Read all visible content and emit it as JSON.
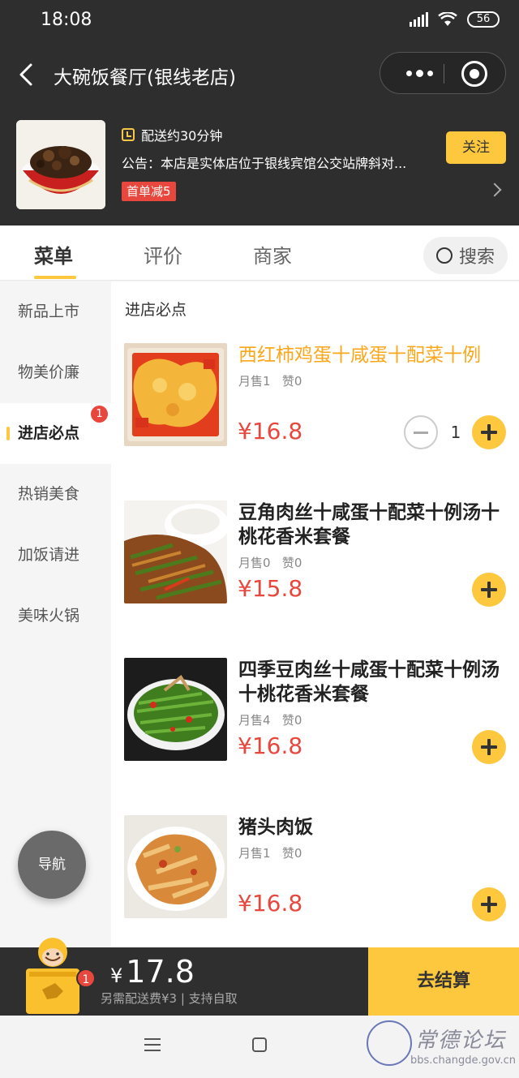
{
  "status_bar": {
    "time": "18:08",
    "battery": "56"
  },
  "header": {
    "title": "大碗饭餐厅(银线老店)"
  },
  "shop": {
    "delivery": "配送约30分钟",
    "notice": "公告：本店是实体店位于银线宾馆公交站牌斜对...",
    "promo": "首单减5",
    "follow_label": "关注"
  },
  "tabs": [
    {
      "label": "菜单",
      "active": true
    },
    {
      "label": "评价",
      "active": false
    },
    {
      "label": "商家",
      "active": false
    }
  ],
  "search_label": "搜索",
  "sidebar": {
    "items": [
      {
        "label": "新品上市"
      },
      {
        "label": "物美价廉"
      },
      {
        "label": "进店必点",
        "active": true,
        "badge": "1"
      },
      {
        "label": "热销美食"
      },
      {
        "label": "加饭请进"
      },
      {
        "label": "美味火锅"
      }
    ],
    "nav_button": "导航"
  },
  "section_title": "进店必点",
  "dishes": [
    {
      "name": "西红柿鸡蛋十咸蛋十配菜十例",
      "sales": "月售1",
      "likes": "赞0",
      "price": "¥16.8",
      "quantity": "1"
    },
    {
      "name": "豆角肉丝十咸蛋十配菜十例汤十桃花香米套餐",
      "sales": "月售0",
      "likes": "赞0",
      "price": "¥15.8"
    },
    {
      "name": "四季豆肉丝十咸蛋十配菜十例汤十桃花香米套餐",
      "sales": "月售4",
      "likes": "赞0",
      "price": "¥16.8"
    },
    {
      "name": "猪头肉饭",
      "sales": "月售1",
      "likes": "赞0",
      "price": "¥16.8"
    }
  ],
  "cart": {
    "currency": "¥",
    "amount": "17.8",
    "subtext": "另需配送费¥3 | 支持自取",
    "badge": "1",
    "checkout_label": "去结算"
  },
  "watermark": {
    "text": "常德论坛",
    "url": "bbs.changde.gov.cn"
  },
  "colors": {
    "accent": "#fdc73e",
    "price": "#e8473d",
    "header_bg": "#2e2e2e"
  }
}
